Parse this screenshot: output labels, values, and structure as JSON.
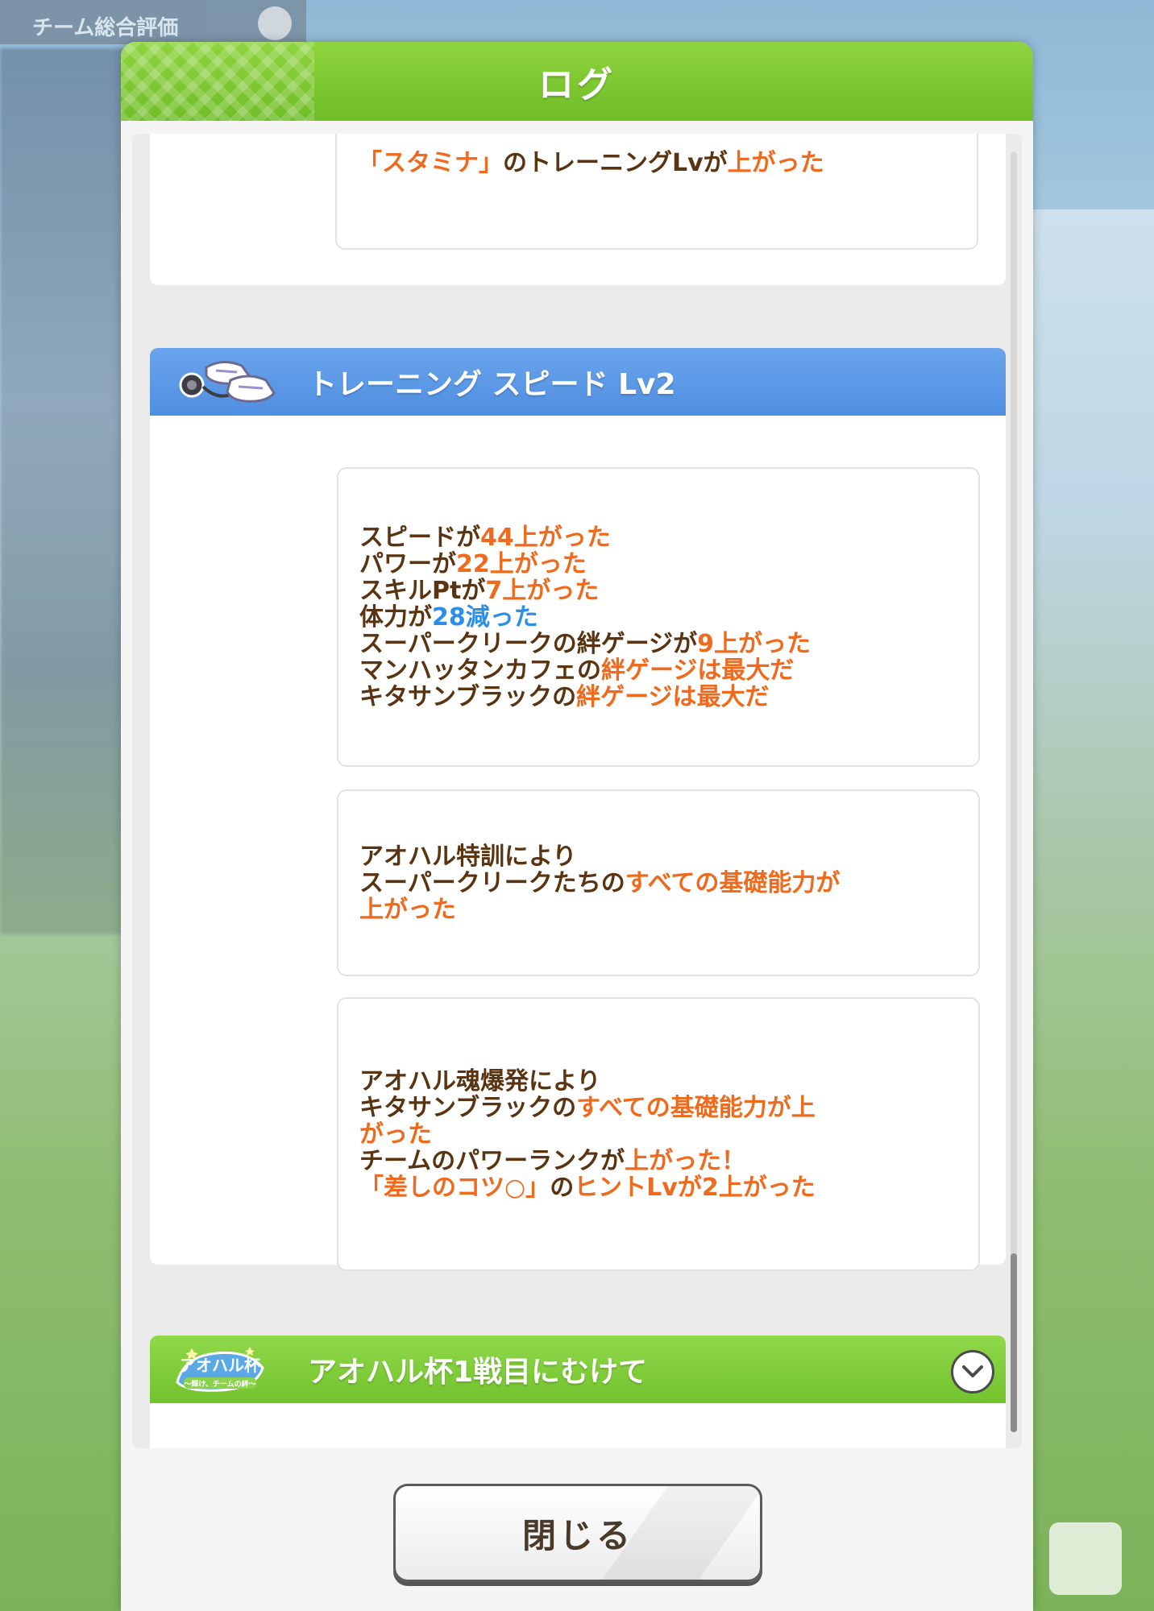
{
  "background": {
    "team_label": "チーム総合評価"
  },
  "dialog": {
    "title": "ログ"
  },
  "log": {
    "prev_entry": {
      "parts": [
        {
          "text": "「スタミナ」",
          "color": "orange"
        },
        {
          "text": "のトレーニングLvが",
          "color": "brown"
        },
        {
          "text": "上がった",
          "color": "orange"
        }
      ]
    },
    "training_section": {
      "title": "トレーニング スピード Lv2",
      "icon": "sneakers-stopwatch-icon",
      "entries": [
        {
          "lines": [
            [
              {
                "text": "スピードが",
                "color": "brown"
              },
              {
                "text": "44上がった",
                "color": "orange"
              }
            ],
            [
              {
                "text": "パワーが",
                "color": "brown"
              },
              {
                "text": "22上がった",
                "color": "orange"
              }
            ],
            [
              {
                "text": "スキルPtが",
                "color": "brown"
              },
              {
                "text": "7上がった",
                "color": "orange"
              }
            ],
            [
              {
                "text": "体力が",
                "color": "brown"
              },
              {
                "text": "28減った",
                "color": "blue"
              }
            ],
            [
              {
                "text": "スーパークリークの絆ゲージが",
                "color": "brown"
              },
              {
                "text": "9上がった",
                "color": "orange"
              }
            ],
            [
              {
                "text": "マンハッタンカフェの",
                "color": "brown"
              },
              {
                "text": "絆ゲージは最大だ",
                "color": "orange"
              }
            ],
            [
              {
                "text": "キタサンブラックの",
                "color": "brown"
              },
              {
                "text": "絆ゲージは最大だ",
                "color": "orange"
              }
            ]
          ]
        },
        {
          "lines": [
            [
              {
                "text": "アオハル特訓により",
                "color": "brown"
              }
            ],
            [
              {
                "text": "スーパークリークたちの",
                "color": "brown"
              },
              {
                "text": "すべての基礎能力が",
                "color": "orange"
              }
            ],
            [
              {
                "text": "上がった",
                "color": "orange"
              }
            ]
          ]
        },
        {
          "lines": [
            [
              {
                "text": "アオハル魂爆発により",
                "color": "brown"
              }
            ],
            [
              {
                "text": "キタサンブラックの",
                "color": "brown"
              },
              {
                "text": "すべての基礎能力が上",
                "color": "orange"
              }
            ],
            [
              {
                "text": "がった",
                "color": "orange"
              }
            ],
            [
              {
                "text": "チームのパワーランクが",
                "color": "brown"
              },
              {
                "text": "上がった！",
                "color": "orange"
              }
            ],
            [
              {
                "text": "「差しのコツ○」",
                "color": "orange"
              },
              {
                "text": "の",
                "color": "brown"
              },
              {
                "text": "ヒントLvが2上がった",
                "color": "orange"
              }
            ]
          ]
        }
      ]
    },
    "event_section": {
      "title": "アオハル杯1戦目にむけて",
      "icon": "aoharu-cup-logo-icon",
      "logo_text": "アオハル杯",
      "logo_subtext": "〜輝け、チームの絆〜"
    }
  },
  "colors": {
    "brown": "#5a3411",
    "orange": "#ef6a1c",
    "blue": "#2d8ee8",
    "header_green": "#7cc52f",
    "section_blue": "#5b98e6"
  },
  "footer": {
    "close_label": "閉じる"
  }
}
